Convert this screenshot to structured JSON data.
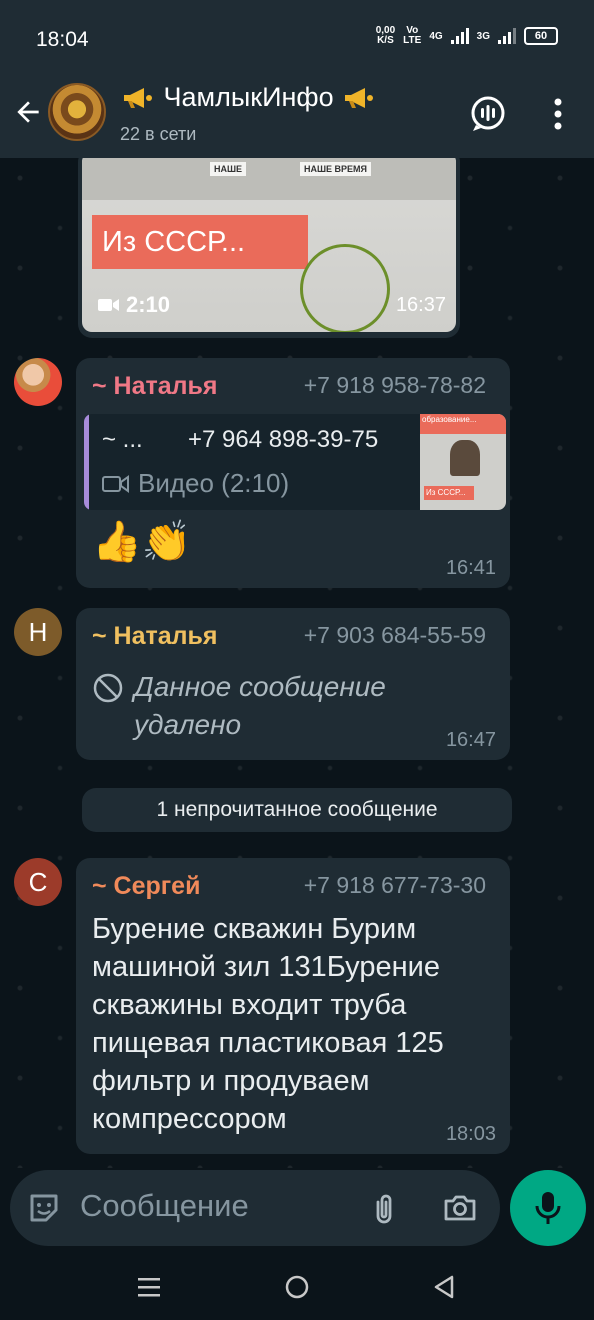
{
  "status_bar": {
    "time": "18:04",
    "net_speed_value": "0,00",
    "net_speed_unit": "K/S",
    "volte_top": "Vo",
    "volte_bottom": "LTE",
    "signal1_label": "4G",
    "signal2_label": "3G",
    "battery": "60"
  },
  "header": {
    "title": "ЧамлыкИнфо",
    "subtitle": "22 в сети",
    "icons": [
      "back-arrow-icon",
      "megaphone-icon",
      "voice-chat-icon",
      "more-vert-icon"
    ]
  },
  "messages": [
    {
      "type": "video",
      "video_label": "Из СССР...",
      "thumb_sign1": "НАШЕ",
      "thumb_sign2": "НАШЕ ВРЕМЯ",
      "duration": "2:10",
      "time": "16:37"
    },
    {
      "type": "reply",
      "sender": "~ Наталья",
      "sender_color": "#f07886",
      "phone": "+7 918 958-78-82",
      "reply_to_name": "~ ...",
      "reply_to_phone": "+7 964 898-39-75",
      "reply_media": "Видео (2:10)",
      "reply_thumb_top": "образование...",
      "reply_thumb_label": "Из СССР...",
      "text": "👍👏",
      "time": "16:41"
    },
    {
      "type": "deleted",
      "avatar_letter": "Н",
      "avatar_color": "#7d5b2a",
      "sender": "~ Наталья",
      "sender_color": "#f0c060",
      "phone": "+7 903 684-55-59",
      "text": "Данное сообщение удалено",
      "time": "16:47"
    },
    {
      "type": "text",
      "avatar_letter": "С",
      "avatar_color": "#9c3b2a",
      "sender": "~ Сергей",
      "sender_color": "#f08a5a",
      "phone": "+7 918 677-73-30",
      "text": "Бурение скважин Бурим машиной зил 131Бурение скважины входит труба пищевая пластиковая 125 фильтр и продуваем компрессором",
      "time": "18:03"
    }
  ],
  "unread_divider": "1 непрочитанное сообщение",
  "composer": {
    "placeholder": "Сообщение",
    "icons": [
      "sticker-icon",
      "attach-icon",
      "camera-icon",
      "mic-icon"
    ],
    "accent": "#00a884"
  },
  "navbar": {
    "icons": [
      "recent-apps-icon",
      "home-icon",
      "back-triangle-icon"
    ]
  }
}
